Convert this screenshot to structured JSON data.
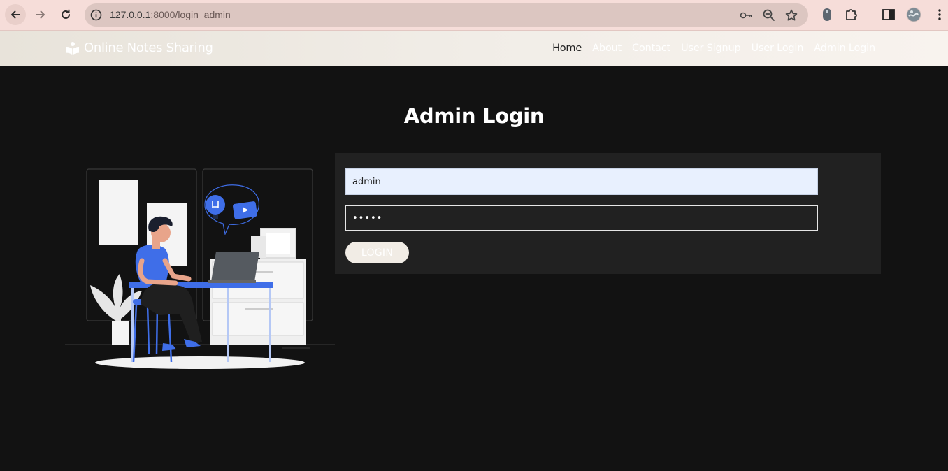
{
  "browser": {
    "url_host": "127.0.0.1",
    "url_path": ":8000/login_admin",
    "icons": [
      "back-icon",
      "forward-icon",
      "reload-icon",
      "site-info-icon",
      "password-key-icon",
      "zoom-icon",
      "bookmark-star-icon",
      "extension-mouse-icon",
      "extensions-puzzle-icon",
      "side-panel-icon",
      "profile-avatar-icon",
      "menu-kebab-icon"
    ]
  },
  "navbar": {
    "brand": "Online Notes Sharing",
    "menu": [
      "Home",
      "About",
      "Contact",
      "User Signup",
      "User Login",
      "Admin Login"
    ],
    "active": "Home"
  },
  "page": {
    "title": "Admin Login"
  },
  "form": {
    "username_value": "admin",
    "password_mask": "•••••",
    "submit_label": "LOGIN"
  },
  "colors": {
    "page_bg": "#121212",
    "panel_bg": "#212121",
    "autofill_bg": "#e8f0fe",
    "accent_blue": "#3f6ee8"
  }
}
